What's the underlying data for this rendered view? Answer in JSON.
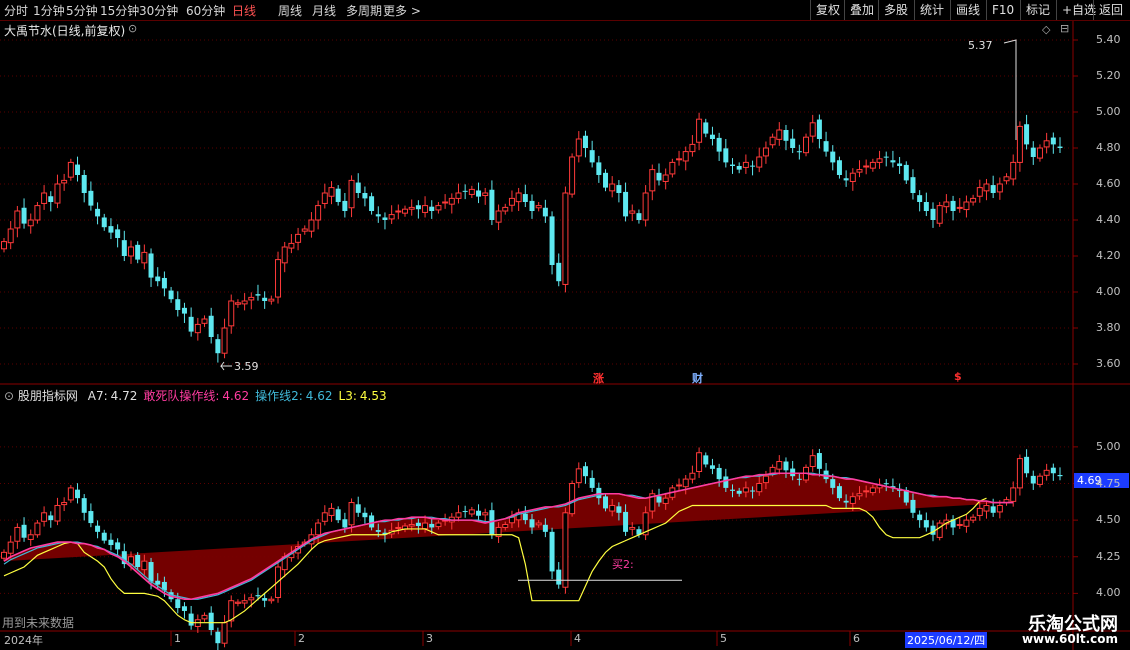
{
  "toolbar": {
    "periods": [
      "分时",
      "1分钟",
      "5分钟",
      "15分钟",
      "30分钟",
      "60分钟",
      "日线",
      "周线",
      "月线",
      "多周期",
      "更多 >"
    ],
    "active_period": "日线",
    "right_buttons": [
      "复权",
      "叠加",
      "多股",
      "统计",
      "画线",
      "F10",
      "标记",
      "+自选",
      "返回"
    ]
  },
  "main_panel": {
    "title": "大禹节水(日线,前复权)",
    "high_annotation": "5.37",
    "low_annotation": "3.59",
    "events": [
      {
        "label": "涨",
        "color": "#ff3030"
      },
      {
        "label": "财",
        "color": "#7fb0ff"
      },
      {
        "label": "$",
        "color": "#ff3030"
      }
    ]
  },
  "indicator_panel": {
    "name": "股朋指标网",
    "values": [
      {
        "label": "A7:",
        "value": "4.72",
        "color": "#e0e0e0"
      },
      {
        "label": "敢死队操作线:",
        "value": "4.62",
        "color": "#ff3ca0"
      },
      {
        "label": "操作线2:",
        "value": "4.62",
        "color": "#40b8d8"
      },
      {
        "label": "L3:",
        "value": "4.53",
        "color": "#ffff40"
      }
    ],
    "current_price_tag": "4.69",
    "marker_text": "买2:",
    "footer_note": "用到未来数据"
  },
  "chart_data": [
    {
      "type": "candlestick",
      "title": "大禹节水(日线,前复权)",
      "ylim": [
        3.5,
        5.5
      ],
      "y_ticks": [
        3.6,
        3.8,
        4.0,
        4.2,
        4.4,
        4.6,
        4.8,
        5.0,
        5.2,
        5.4
      ],
      "y_tick_labels": [
        "3.60",
        "3.80",
        "4.00",
        "4.20",
        "4.40",
        "4.60",
        "4.80",
        "5.00",
        "5.20",
        "5.40"
      ],
      "x_labels": [
        "2024年",
        "1",
        "2",
        "3",
        "4",
        "5",
        "6",
        "2025/06/12/四"
      ],
      "close": [
        4.28,
        4.35,
        4.45,
        4.38,
        4.4,
        4.48,
        4.55,
        4.5,
        4.6,
        4.62,
        4.72,
        4.65,
        4.55,
        4.48,
        4.42,
        4.36,
        4.33,
        4.3,
        4.2,
        4.25,
        4.18,
        4.22,
        4.08,
        4.06,
        4.02,
        3.96,
        3.9,
        3.88,
        3.78,
        3.82,
        3.85,
        3.75,
        3.66,
        3.8,
        3.95,
        3.94,
        3.95,
        3.97,
        3.98,
        3.95,
        3.96,
        4.18,
        4.25,
        4.27,
        4.32,
        4.35,
        4.4,
        4.48,
        4.55,
        4.58,
        4.5,
        4.45,
        4.62,
        4.55,
        4.52,
        4.45,
        4.42,
        4.4,
        4.43,
        4.45,
        4.46,
        4.47,
        4.46,
        4.48,
        4.45,
        4.48,
        4.5,
        4.52,
        4.55,
        4.56,
        4.57,
        4.53,
        4.55,
        4.4,
        4.45,
        4.47,
        4.52,
        4.55,
        4.5,
        4.45,
        4.48,
        4.42,
        4.15,
        4.06,
        4.55,
        4.75,
        4.85,
        4.8,
        4.72,
        4.65,
        4.58,
        4.6,
        4.55,
        4.42,
        4.45,
        4.4,
        4.55,
        4.68,
        4.62,
        4.65,
        4.72,
        4.74,
        4.78,
        4.82,
        4.96,
        4.88,
        4.85,
        4.78,
        4.72,
        4.7,
        4.68,
        4.72,
        4.7,
        4.75,
        4.8,
        4.86,
        4.9,
        4.84,
        4.8,
        4.78,
        4.86,
        4.94,
        4.85,
        4.78,
        4.72,
        4.65,
        4.62,
        4.66,
        4.68,
        4.7,
        4.72,
        4.74,
        4.75,
        4.72,
        4.7,
        4.62,
        4.55,
        4.5,
        4.45,
        4.4,
        4.48,
        4.5,
        4.45,
        4.47,
        4.5,
        4.52,
        4.58,
        4.6,
        4.55,
        4.6,
        4.64,
        4.72,
        4.92,
        4.82,
        4.75,
        4.8,
        4.84,
        4.82,
        4.8
      ]
    },
    {
      "type": "line",
      "ylim": [
        3.75,
        5.32
      ],
      "y_ticks": [
        4.0,
        4.25,
        4.5,
        4.75,
        5.0
      ],
      "y_tick_labels": [
        "4.00",
        "4.25",
        "4.50",
        "4.75",
        "5.00"
      ],
      "series": [
        {
          "name": "敢死队操作线",
          "color": "#ff3ca0",
          "values": [
            4.22,
            4.25,
            4.27,
            4.29,
            4.31,
            4.32,
            4.33,
            4.34,
            4.35,
            4.35,
            4.35,
            4.34,
            4.34,
            4.33,
            4.31,
            4.3,
            4.27,
            4.25,
            4.22,
            4.18,
            4.14,
            4.1,
            4.06,
            4.03,
            4.0,
            3.98,
            3.97,
            3.96,
            3.96,
            3.97,
            3.98,
            3.99,
            4.0,
            4.02,
            4.04,
            4.06,
            4.08,
            4.1,
            4.13,
            4.16,
            4.19,
            4.22,
            4.25,
            4.28,
            4.31,
            4.34,
            4.37,
            4.39,
            4.41,
            4.42,
            4.43,
            4.44,
            4.45,
            4.46,
            4.47,
            4.48,
            4.49,
            4.5,
            4.5,
            4.51,
            4.51,
            4.52,
            4.52,
            4.52,
            4.51,
            4.51,
            4.5,
            4.5,
            4.5,
            4.5,
            4.5,
            4.49,
            4.48,
            4.49,
            4.5,
            4.51,
            4.53,
            4.55,
            4.56,
            4.57,
            4.58,
            4.59,
            4.59,
            4.6,
            4.61,
            4.63,
            4.65,
            4.66,
            4.67,
            4.68,
            4.68,
            4.68,
            4.68,
            4.67,
            4.66,
            4.65,
            4.65,
            4.66,
            4.67,
            4.68,
            4.69,
            4.7,
            4.71,
            4.72,
            4.73,
            4.74,
            4.75,
            4.76,
            4.77,
            4.78,
            4.79,
            4.8,
            4.8,
            4.81,
            4.81,
            4.82,
            4.82,
            4.82,
            4.82,
            4.82,
            4.82,
            4.81,
            4.81,
            4.8,
            4.8,
            4.79,
            4.78,
            4.78,
            4.77,
            4.76,
            4.75,
            4.74,
            4.73,
            4.72,
            4.71,
            4.7,
            4.69,
            4.68,
            4.67,
            4.66,
            4.66,
            4.66,
            4.65,
            4.65,
            4.64,
            4.64,
            4.63,
            4.63,
            4.62,
            4.62,
            4.62,
            4.62
          ]
        },
        {
          "name": "操作线2",
          "color": "#40b8d8",
          "values": [
            4.2,
            4.23,
            4.25,
            4.27,
            4.29,
            4.31,
            4.32,
            4.33,
            4.34,
            4.35,
            4.35,
            4.35,
            4.34,
            4.33,
            4.32,
            4.3,
            4.28,
            4.26,
            4.23,
            4.2,
            4.16,
            4.12,
            4.08,
            4.05,
            4.02,
            3.99,
            3.98,
            3.97,
            3.96,
            3.96,
            3.97,
            3.98,
            3.99,
            4.01,
            4.03,
            4.05,
            4.07,
            4.09,
            4.12,
            4.15,
            4.18,
            4.21,
            4.24,
            4.27,
            4.3,
            4.33,
            4.36,
            4.38,
            4.4,
            4.42,
            4.43,
            4.44,
            4.45,
            4.46,
            4.47,
            4.48,
            4.49,
            4.49,
            4.5,
            4.5,
            4.51,
            4.51,
            4.52,
            4.52,
            4.52,
            4.51,
            4.51,
            4.5,
            4.5,
            4.5,
            4.5,
            4.5,
            4.49,
            4.49,
            4.5,
            4.51,
            4.52,
            4.54,
            4.55,
            4.56,
            4.57,
            4.58,
            4.59,
            4.59,
            4.6,
            4.62,
            4.64,
            4.65,
            4.66,
            4.67,
            4.68,
            4.68,
            4.68,
            4.67,
            4.67,
            4.66,
            4.65,
            4.66,
            4.67,
            4.68,
            4.69,
            4.7,
            4.71,
            4.72,
            4.73,
            4.74,
            4.75,
            4.76,
            4.77,
            4.78,
            4.79,
            4.79,
            4.8,
            4.8,
            4.81,
            4.81,
            4.82,
            4.82,
            4.82,
            4.82,
            4.82,
            4.82,
            4.81,
            4.81,
            4.8,
            4.79,
            4.79,
            4.78,
            4.77,
            4.76,
            4.75,
            4.74,
            4.73,
            4.72,
            4.71,
            4.7,
            4.69,
            4.68,
            4.67,
            4.67,
            4.66,
            4.66,
            4.65,
            4.65,
            4.64,
            4.64,
            4.63,
            4.63,
            4.62,
            4.62,
            4.62,
            4.62
          ]
        },
        {
          "name": "L3",
          "color": "#ffff40",
          "values": [
            4.12,
            4.14,
            4.16,
            4.18,
            4.22,
            4.26,
            4.28,
            4.3,
            4.32,
            4.34,
            4.35,
            4.34,
            4.28,
            4.25,
            4.22,
            4.18,
            4.1,
            4.04,
            4.0,
            4.0,
            4.0,
            4.0,
            3.99,
            3.98,
            3.95,
            3.9,
            3.85,
            3.82,
            3.8,
            3.8,
            3.8,
            3.8,
            3.8,
            3.8,
            3.82,
            3.85,
            3.88,
            3.92,
            3.96,
            4.0,
            4.04,
            4.08,
            4.12,
            4.16,
            4.2,
            4.25,
            4.3,
            4.34,
            4.36,
            4.37,
            4.38,
            4.39,
            4.4,
            4.4,
            4.4,
            4.4,
            4.4,
            4.4,
            4.42,
            4.43,
            4.44,
            4.44,
            4.44,
            4.44,
            4.42,
            4.4,
            4.4,
            4.4,
            4.4,
            4.4,
            4.4,
            4.4,
            4.4,
            4.4,
            4.4,
            4.4,
            4.4,
            4.38,
            4.2,
            3.95,
            3.95,
            3.95,
            3.95,
            3.95,
            3.95,
            3.95,
            3.95,
            4.05,
            4.15,
            4.22,
            4.28,
            4.32,
            4.34,
            4.36,
            4.38,
            4.4,
            4.42,
            4.44,
            4.46,
            4.48,
            4.52,
            4.56,
            4.58,
            4.6,
            4.6,
            4.6,
            4.6,
            4.6,
            4.6,
            4.6,
            4.6,
            4.6,
            4.6,
            4.6,
            4.6,
            4.6,
            4.6,
            4.6,
            4.6,
            4.6,
            4.6,
            4.6,
            4.6,
            4.6,
            4.58,
            4.58,
            4.58,
            4.58,
            4.58,
            4.56,
            4.52,
            4.45,
            4.4,
            4.38,
            4.38,
            4.38,
            4.38,
            4.38,
            4.4,
            4.42,
            4.45,
            4.48,
            4.5,
            4.52,
            4.54,
            4.58,
            4.63,
            4.65
          ]
        }
      ]
    }
  ]
}
